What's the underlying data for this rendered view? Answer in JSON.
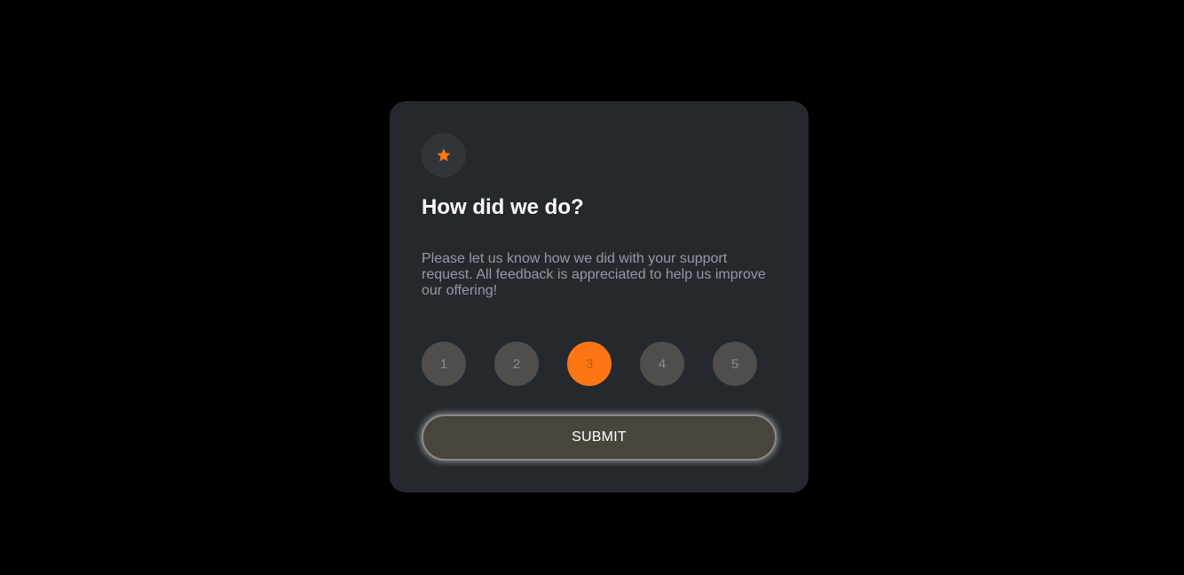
{
  "card": {
    "icon": "star-icon",
    "title": "How did we do?",
    "description": "Please let us know how we did with your support request. All feedback is appreciated to help us improve our offering!",
    "ratings": [
      "1",
      "2",
      "3",
      "4",
      "5"
    ],
    "selected_rating": "3",
    "submit_label": "SUBMIT"
  },
  "colors": {
    "page_background": "#000000",
    "card_background": "#25282d",
    "accent": "#fc7614",
    "rating_background": "#4f4e4c",
    "description_text": "#959ba3",
    "button_background": "#48453f"
  }
}
